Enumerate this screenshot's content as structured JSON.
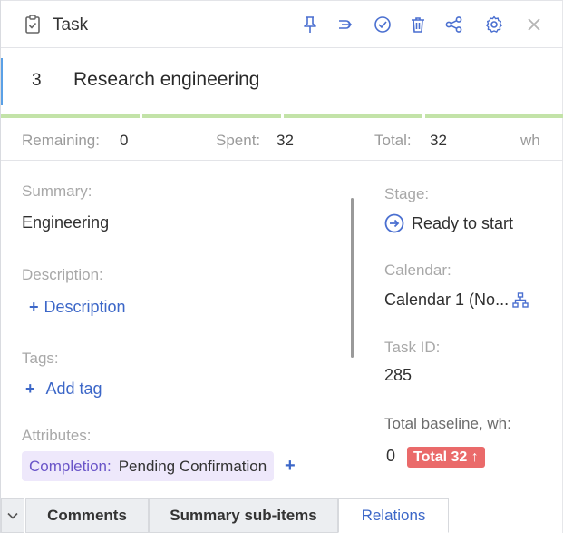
{
  "header": {
    "title": "Task",
    "toolbar_icons": [
      "pin-icon",
      "link-icon",
      "check-circle-icon",
      "trash-icon",
      "share-icon",
      "gear-icon",
      "close-icon"
    ]
  },
  "task": {
    "number": "3",
    "name": "Research engineering",
    "progress_segments": 4
  },
  "metrics": {
    "remaining_label": "Remaining:",
    "remaining_value": "0",
    "spent_label": "Spent:",
    "spent_value": "32",
    "total_label": "Total:",
    "total_value": "32",
    "unit": "wh"
  },
  "left": {
    "summary_label": "Summary:",
    "summary_value": "Engineering",
    "description_label": "Description:",
    "description_link": "Description",
    "tags_label": "Tags:",
    "tags_link": "Add tag",
    "attributes_label": "Attributes:",
    "attribute_key": "Completion:",
    "attribute_value": "Pending Confirmation",
    "attribute_add": "+"
  },
  "right": {
    "stage_label": "Stage:",
    "stage_value": "Ready to start",
    "calendar_label": "Calendar:",
    "calendar_value": "Calendar 1 (No...",
    "task_id_label": "Task ID:",
    "task_id_value": "285",
    "baseline_label": "Total baseline, wh:",
    "baseline_value": "0",
    "baseline_badge": "Total 32 ↑"
  },
  "tabs": [
    {
      "label": "Comments",
      "active": false
    },
    {
      "label": "Summary sub-items",
      "active": false
    },
    {
      "label": "Relations",
      "active": true
    }
  ],
  "colors": {
    "accent_blue": "#3c67c8",
    "progress_green": "#c3e3a8",
    "badge_red": "#ea6a6a",
    "chip_bg": "#eee8fb"
  }
}
